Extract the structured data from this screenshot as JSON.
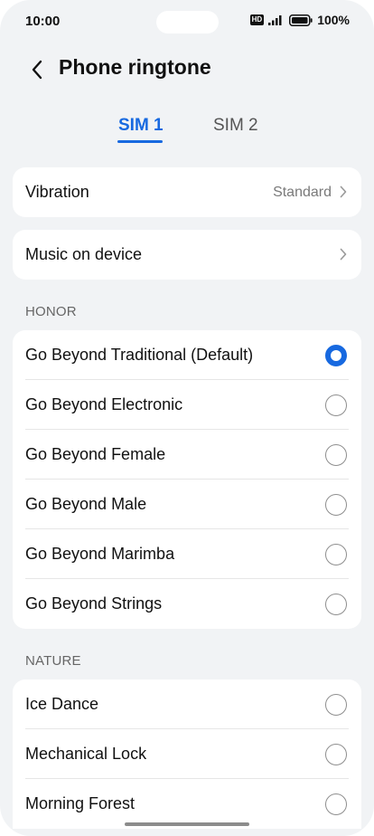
{
  "status": {
    "time": "10:00",
    "hd": "HD",
    "battery": "100%"
  },
  "header": {
    "title": "Phone ringtone"
  },
  "tabs": [
    {
      "label": "SIM 1",
      "active": true
    },
    {
      "label": "SIM 2",
      "active": false
    }
  ],
  "vibration": {
    "label": "Vibration",
    "value": "Standard"
  },
  "music": {
    "label": "Music on device"
  },
  "sections": [
    {
      "title": "HONOR",
      "items": [
        {
          "label": "Go Beyond Traditional (Default)",
          "selected": true
        },
        {
          "label": "Go Beyond Electronic",
          "selected": false
        },
        {
          "label": "Go Beyond Female",
          "selected": false
        },
        {
          "label": "Go Beyond Male",
          "selected": false
        },
        {
          "label": "Go Beyond Marimba",
          "selected": false
        },
        {
          "label": "Go Beyond Strings",
          "selected": false
        }
      ]
    },
    {
      "title": "NATURE",
      "items": [
        {
          "label": "Ice Dance",
          "selected": false
        },
        {
          "label": "Mechanical Lock",
          "selected": false
        },
        {
          "label": "Morning Forest",
          "selected": false
        }
      ]
    }
  ],
  "colors": {
    "accent": "#1769e0",
    "background": "#f1f3f5"
  }
}
